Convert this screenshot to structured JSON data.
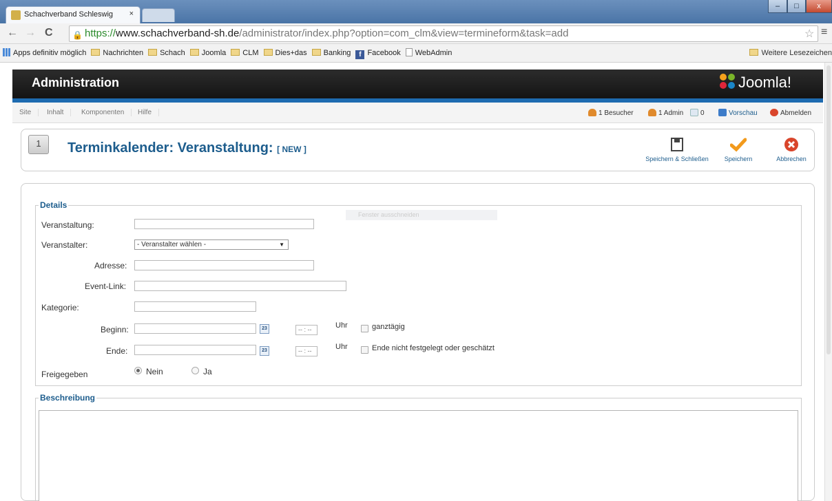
{
  "browser": {
    "tab_title": "Schachverband Schleswig",
    "tab_close": "×",
    "window_controls": {
      "minimize": "–",
      "maximize": "□",
      "close": "x"
    },
    "url": {
      "scheme": "https://",
      "host": "www.schachverband-sh.de",
      "path": "/administrator/index.php?option=com_clm&view=termineform&task=add"
    },
    "nav": {
      "back": "←",
      "forward": "→",
      "reload": "C"
    },
    "star": "☆",
    "menu": "≡",
    "bookmarks": {
      "apps": "Apps definitiv möglich",
      "items": [
        "Nachrichten",
        "Schach",
        "Joomla",
        "CLM",
        "Dies+das",
        "Banking"
      ],
      "facebook": "Facebook",
      "webadmin": "WebAdmin",
      "other": "Weitere Lesezeichen"
    }
  },
  "admin": {
    "header_title": "Administration",
    "logo_text": "Joomla!",
    "menu": [
      "Site",
      "Inhalt",
      "Komponenten",
      "Hilfe"
    ],
    "status": {
      "visitors": "1 Besucher",
      "admins": "1 Admin",
      "messages": "0",
      "preview": "Vorschau",
      "logout": "Abmelden"
    }
  },
  "page": {
    "title": "Terminkalender: Veranstaltung:",
    "title_tag": "[ NEW ]",
    "calendar_icon_day": "1",
    "toolbar": {
      "save_close": "Speichern & Schließen",
      "save": "Speichern",
      "cancel": "Abbrechen"
    }
  },
  "form": {
    "details_legend": "Details",
    "ghost_tooltip": "Fenster ausschneiden",
    "labels": {
      "veranstaltung": "Veranstaltung:",
      "veranstalter": "Veranstalter:",
      "adresse": "Adresse:",
      "event_link": "Event-Link:",
      "kategorie": "Kategorie:",
      "beginn": "Beginn:",
      "ende": "Ende:",
      "freigegeben": "Freigegeben",
      "uhr": "Uhr",
      "ganztaegig": "ganztägig",
      "ende_offen": "Ende nicht festgelegt oder geschätzt",
      "nein": "Nein",
      "ja": "Ja"
    },
    "values": {
      "veranstaltung": "",
      "veranstalter_selected": "- Veranstalter wählen -",
      "adresse": "",
      "event_link": "",
      "kategorie": "",
      "beginn_date": "",
      "beginn_time": "-- : --",
      "ende_date": "",
      "ende_time": "-- : --",
      "ganztaegig_checked": false,
      "ende_offen_checked": false,
      "freigegeben": "Nein"
    },
    "calendar_button": "23",
    "select_arrow": "▼",
    "beschreibung_legend": "Beschreibung"
  },
  "colors": {
    "accent_blue": "#1d5d8d",
    "header_dark": "#1a1a1a",
    "joomla_bar": "#1e6bb0",
    "save_check": "#f29a1c",
    "cancel_red": "#d9452b"
  }
}
